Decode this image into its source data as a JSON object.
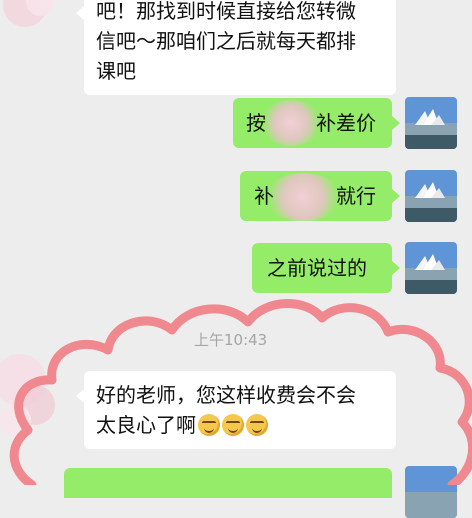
{
  "messages": [
    {
      "side": "left",
      "text_lines": [
        "吧！那找到时候直接给您转微",
        "信吧～那咱们之后就每天都排",
        "课吧"
      ]
    },
    {
      "side": "right",
      "text_left": "按",
      "text_right": "补差价"
    },
    {
      "side": "right",
      "text_left": "补",
      "text_right": "就行"
    },
    {
      "side": "right",
      "text": "之前说过的"
    },
    {
      "side": "left",
      "text_line1": "好的老师，您这样收费会不会",
      "text_line2": "太良心了啊"
    }
  ],
  "timestamp": "上午10:43",
  "emoji_icons": [
    "facepalm-emoji",
    "facepalm-emoji",
    "facepalm-emoji"
  ],
  "colors": {
    "background": "#ededed",
    "incoming_bubble": "#ffffff",
    "outgoing_bubble": "#95ec69",
    "cloud_outline": "#f0898f"
  }
}
